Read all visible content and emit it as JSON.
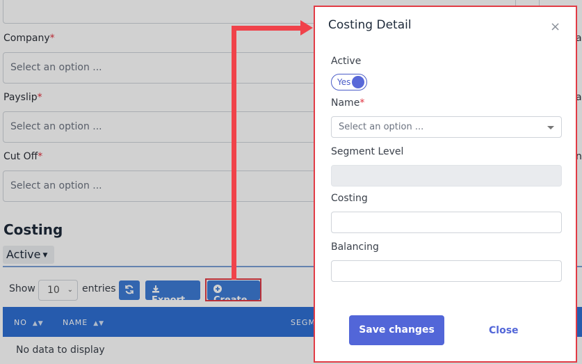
{
  "form": {
    "company_label": "Company",
    "payslip_label": "Payslip",
    "cutoff_label": "Cut Off",
    "required_mark": "*",
    "select_placeholder": "Select an option ...",
    "right_fragments": [
      "a",
      "a",
      "n"
    ]
  },
  "costing": {
    "section_title": "Costing",
    "tab_label": "Active",
    "show_label": "Show",
    "entries_value": "10",
    "entries_label": "entries",
    "export_label": "Export",
    "create_label": "Create",
    "columns": [
      "NO",
      "NAME",
      "SEGM"
    ],
    "empty_text": "No data to display"
  },
  "modal": {
    "title": "Costing Detail",
    "close_symbol": "×",
    "active_label": "Active",
    "toggle_text": "Yes",
    "name_label": "Name",
    "name_placeholder": "Select an option ...",
    "segment_level_label": "Segment Level",
    "costing_label": "Costing",
    "balancing_label": "Balancing",
    "save_label": "Save changes",
    "close_label": "Close"
  },
  "colors": {
    "accent": "#5266d8",
    "table_header": "#2f6fd3",
    "annotation": "#e23b45"
  }
}
